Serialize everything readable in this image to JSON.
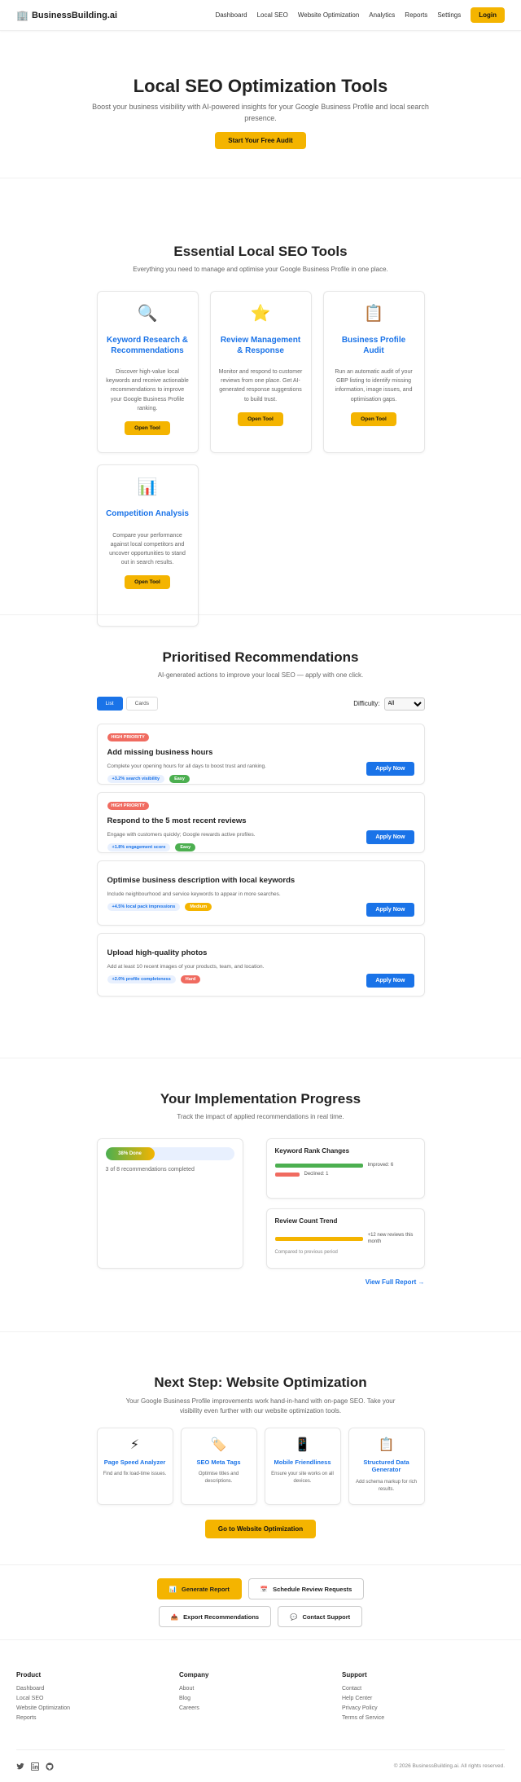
{
  "nav": {
    "brand": "BusinessBuilding.ai",
    "links": [
      "Dashboard",
      "Local SEO",
      "Website Optimization",
      "Analytics",
      "Reports",
      "Settings"
    ],
    "login": "Login"
  },
  "hero": {
    "title": "Local SEO Optimization Tools",
    "subtitle": "Boost your business visibility with AI-powered insights for your Google Business Profile and local search presence.",
    "cta": "Start Your Free Audit"
  },
  "tools": {
    "title": "Essential Local SEO Tools",
    "subtitle": "Everything you need to manage and optimise your Google Business Profile in one place.",
    "cards": [
      {
        "icon": "🔍",
        "title": "Keyword Research & Recommendations",
        "desc": "Discover high-value local keywords and receive actionable recommendations to improve your Google Business Profile ranking.",
        "button": "Open Tool"
      },
      {
        "icon": "⭐",
        "title": "Review Management & Response",
        "desc": "Monitor and respond to customer reviews from one place. Get AI-generated response suggestions to build trust.",
        "button": "Open Tool"
      },
      {
        "icon": "📋",
        "title": "Business Profile Audit",
        "desc": "Run an automatic audit of your GBP listing to identify missing information, image issues, and optimisation gaps.",
        "button": "Open Tool"
      },
      {
        "icon": "📊",
        "title": "Competition Analysis",
        "desc": "Compare your performance against local competitors and uncover opportunities to stand out in search results.",
        "button": "Open Tool"
      }
    ]
  },
  "recommendations": {
    "title": "Prioritised Recommendations",
    "subtitle": "AI-generated actions to improve your local SEO — apply with one click.",
    "view_list": "List",
    "view_cards": "Cards",
    "difficulty_label": "Difficulty:",
    "difficulty_value": "All",
    "items": [
      {
        "priority": "HIGH PRIORITY",
        "title": "Add missing business hours",
        "desc": "Complete your opening hours for all days to boost trust and ranking.",
        "impact": "+3.2% search visibility",
        "level": "Easy",
        "button": "Apply Now"
      },
      {
        "priority": "HIGH PRIORITY",
        "title": "Respond to the 5 most recent reviews",
        "desc": "Engage with customers quickly; Google rewards active profiles.",
        "impact": "+1.8% engagement score",
        "level": "Easy",
        "button": "Apply Now"
      },
      {
        "priority": "",
        "title": "Optimise business description with local keywords",
        "desc": "Include neighbourhood and service keywords to appear in more searches.",
        "impact": "+4.5% local pack impressions",
        "level": "Medium",
        "button": "Apply Now"
      },
      {
        "priority": "",
        "title": "Upload high-quality photos",
        "desc": "Add at least 10 recent images of your products, team, and location.",
        "impact": "+2.0% profile completeness",
        "level": "Hard",
        "button": "Apply Now"
      }
    ],
    "level_colors": {
      "Easy": "#4caf50",
      "Medium": "#f4b400",
      "Hard": "#f06b60"
    }
  },
  "progress": {
    "title": "Your Implementation Progress",
    "subtitle": "Track the impact of applied recommendations in real time.",
    "done_label": "38% Done",
    "done_fraction": 0.38,
    "summary": "3 of 8 recommendations completed",
    "rank_title": "Keyword Rank Changes",
    "improved_label": "Improved: 6",
    "improved": 6,
    "declined_label": "Declined: 1",
    "declined": 1,
    "review_title": "Review Count Trend",
    "review_label": "+12 new reviews this month",
    "review_note": "Compared to previous period",
    "full_report": "View Full Report →"
  },
  "next": {
    "title": "Next Step: Website Optimization",
    "subtitle": "Your Google Business Profile improvements work hand-in-hand with on-page SEO. Take your visibility even further with our website optimization tools.",
    "cards": [
      {
        "icon": "⚡",
        "title": "Page Speed Analyzer",
        "desc": "Find and fix load-time issues."
      },
      {
        "icon": "🏷️",
        "title": "SEO Meta Tags",
        "desc": "Optimise titles and descriptions."
      },
      {
        "icon": "📱",
        "title": "Mobile Friendliness",
        "desc": "Ensure your site works on all devices."
      },
      {
        "icon": "📋",
        "title": "Structured Data Generator",
        "desc": "Add schema markup for rich results."
      }
    ],
    "button": "Go to Website Optimization"
  },
  "actions": {
    "generate": "Generate Report",
    "schedule": "Schedule Review Requests",
    "export": "Export Recommendations",
    "support": "Contact Support"
  },
  "footer": {
    "columns": [
      {
        "title": "Product",
        "links": [
          "Dashboard",
          "Local SEO",
          "Website Optimization",
          "Reports"
        ]
      },
      {
        "title": "Company",
        "links": [
          "About",
          "Blog",
          "Careers"
        ]
      },
      {
        "title": "Support",
        "links": [
          "Contact",
          "Help Center",
          "Privacy Policy",
          "Terms of Service"
        ]
      }
    ],
    "copyright": "© 2026 BusinessBuilding.ai. All rights reserved."
  }
}
